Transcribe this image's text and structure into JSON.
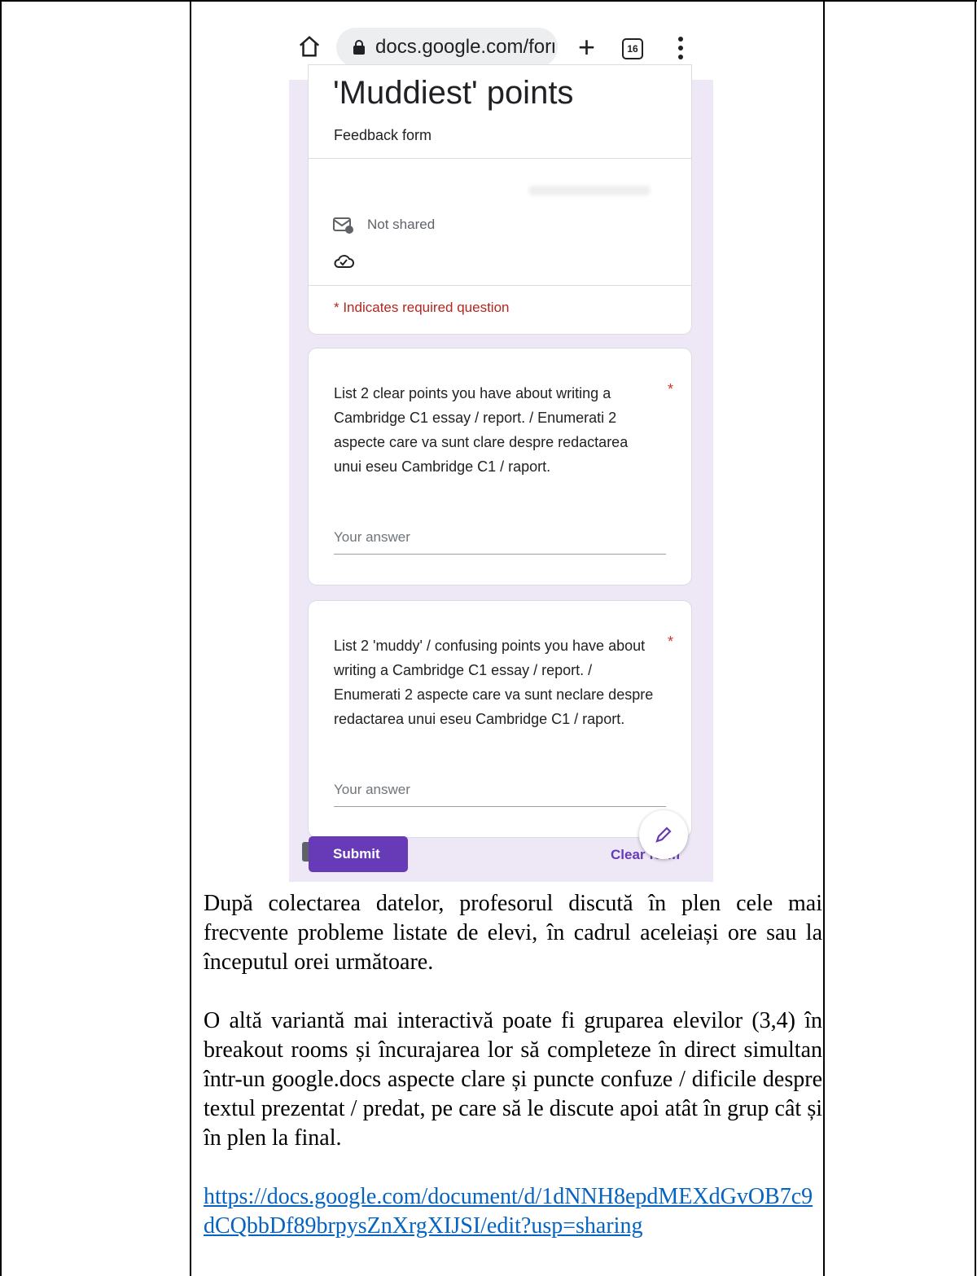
{
  "browser": {
    "url": "docs.google.com/form",
    "tab_count": "16",
    "icons": [
      "home-icon",
      "lock-icon",
      "plus-icon",
      "tabs-icon",
      "menu-icon"
    ]
  },
  "form": {
    "title": "'Muddiest' points",
    "description": "Feedback form",
    "email_status": "Not shared",
    "required_note": "* Indicates required question",
    "questions": [
      {
        "text": "List 2 clear points you have about writing a Cambridge C1 essay / report. / Enumerati 2 aspecte care va sunt clare despre redactarea unui eseu Cambridge C1 / raport.",
        "required_mark": "*",
        "answer_placeholder": "Your answer"
      },
      {
        "text": "List 2 'muddy' / confusing points you have about writing a Cambridge C1 essay / report. / Enumerati 2 aspecte care va sunt neclare despre redactarea unui eseu Cambridge C1 / raport.",
        "required_mark": "*",
        "answer_placeholder": "Your answer"
      }
    ],
    "submit_label": "Submit",
    "clear_label": "Clear form",
    "accent_color": "#673ab7"
  },
  "document": {
    "paragraph1": "După colectarea datelor, profesorul discută în plen cele mai frecvente probleme listate de elevi, în cadrul aceleiași ore sau la începutul orei următoare.",
    "paragraph2": "O altă variantă mai interactivă poate fi gruparea elevilor (3,4) în breakout rooms și încurajarea lor să completeze în direct simultan într-un google.docs aspecte clare și puncte confuze / dificile despre textul prezentat / predat, pe care să le discute apoi atât în grup cât și în plen la final.",
    "link": "https://docs.google.com/document/d/1dNNH8epdMEXdGvOB7c9dCQbbDf89brpysZnXrgXIJSI/edit?usp=sharing"
  }
}
